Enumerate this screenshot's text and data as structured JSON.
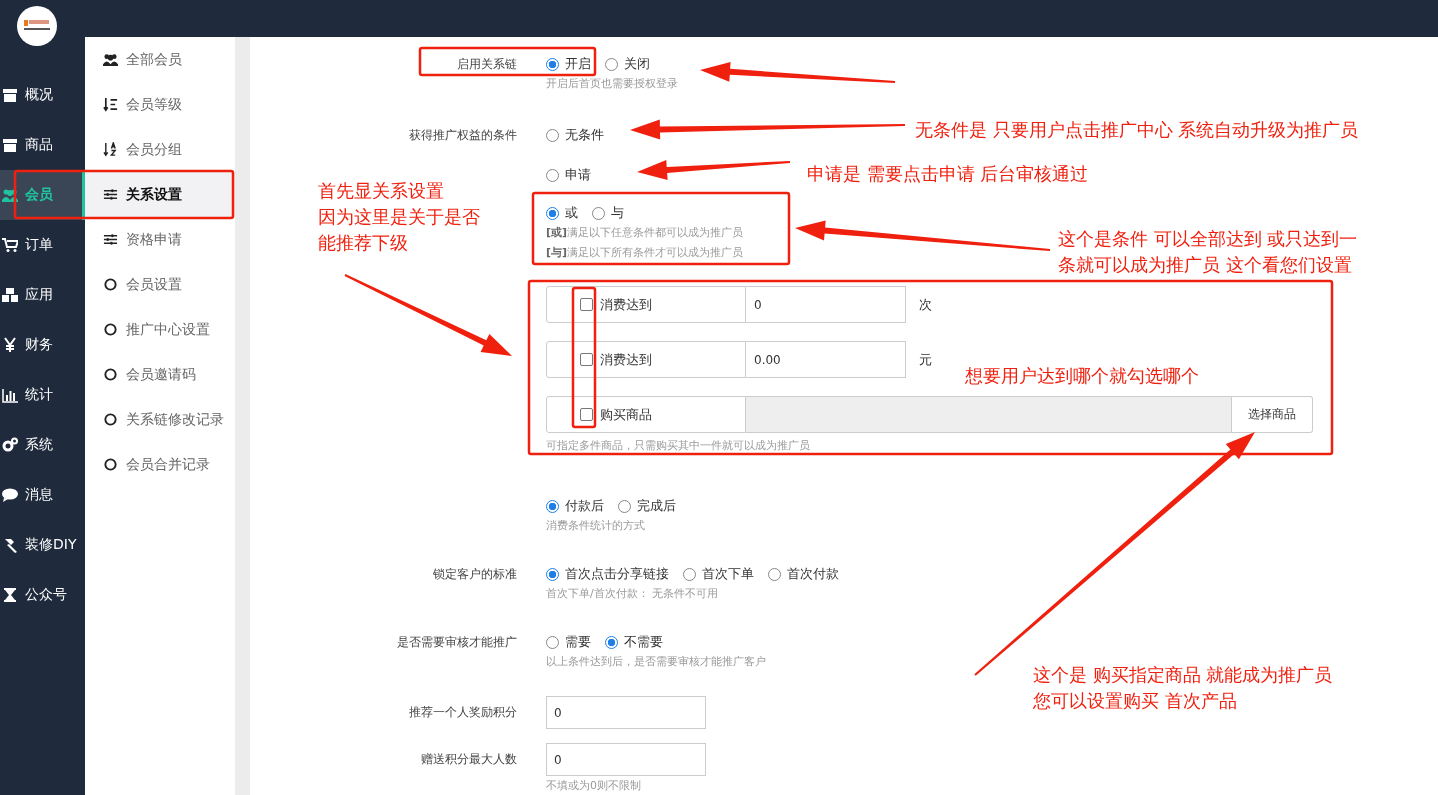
{
  "sidebar": {
    "items": [
      {
        "label": "概况",
        "selected": false
      },
      {
        "label": "商品",
        "selected": false
      },
      {
        "label": "会员",
        "selected": true
      },
      {
        "label": "订单",
        "selected": false
      },
      {
        "label": "应用",
        "selected": false
      },
      {
        "label": "财务",
        "selected": false
      },
      {
        "label": "统计",
        "selected": false
      },
      {
        "label": "系统",
        "selected": false
      },
      {
        "label": "消息",
        "selected": false
      },
      {
        "label": "装修DIY",
        "selected": false
      },
      {
        "label": "公众号",
        "selected": false
      }
    ]
  },
  "submenu": {
    "items": [
      {
        "label": "全部会员",
        "selected": false
      },
      {
        "label": "会员等级",
        "selected": false
      },
      {
        "label": "会员分组",
        "selected": false
      },
      {
        "label": "关系设置",
        "selected": true
      },
      {
        "label": "资格申请",
        "selected": false
      },
      {
        "label": "会员设置",
        "selected": false
      },
      {
        "label": "推广中心设置",
        "selected": false
      },
      {
        "label": "会员邀请码",
        "selected": false
      },
      {
        "label": "关系链修改记录",
        "selected": false
      },
      {
        "label": "会员合并记录",
        "selected": false
      }
    ]
  },
  "form": {
    "rows": [
      {
        "kind": "radio",
        "label": "启用关系链",
        "options": [
          {
            "label": "开启",
            "selected": true
          },
          {
            "label": "关闭",
            "selected": false
          }
        ],
        "hints": [
          "开启后首页也需要授权登录"
        ]
      },
      {
        "kind": "radio",
        "label": "获得推广权益的条件",
        "options": [
          {
            "label": "无条件",
            "selected": false
          }
        ]
      },
      {
        "kind": "radio",
        "options": [
          {
            "label": "申请",
            "selected": false
          }
        ]
      },
      {
        "kind": "radio",
        "options": [
          {
            "label": "或",
            "selected": true
          },
          {
            "label": "与",
            "selected": false
          }
        ],
        "hints": [
          "**[或]**满足以下任意条件都可以成为推广员",
          "**[与]**满足以下所有条件才可以成为推广员"
        ]
      },
      {
        "kind": "conditions",
        "items": [
          {
            "label": "消费达到",
            "checked": false,
            "value": "0",
            "unit": "次"
          },
          {
            "label": "消费达到",
            "checked": false,
            "value": "0.00",
            "unit": "元"
          },
          {
            "label": "购买商品",
            "checked": false,
            "button": "选择商品"
          }
        ],
        "hints": [
          "可指定多件商品，只需购买其中一件就可以成为推广员"
        ]
      },
      {
        "kind": "radio",
        "options": [
          {
            "label": "付款后",
            "selected": true
          },
          {
            "label": "完成后",
            "selected": false
          }
        ],
        "hints": [
          "消费条件统计的方式"
        ]
      },
      {
        "kind": "radio",
        "label": "锁定客户的标准",
        "options": [
          {
            "label": "首次点击分享链接",
            "selected": true
          },
          {
            "label": "首次下单",
            "selected": false
          },
          {
            "label": "首次付款",
            "selected": false
          }
        ],
        "hints": [
          "首次下单/首次付款：  无条件不可用"
        ]
      },
      {
        "kind": "radio",
        "label": "是否需要审核才能推广",
        "options": [
          {
            "label": "需要",
            "selected": false
          },
          {
            "label": "不需要",
            "selected": true
          }
        ],
        "hints": [
          "以上条件达到后，是否需要审核才能推广客户"
        ]
      },
      {
        "kind": "input",
        "label": "推荐一个人奖励积分",
        "value": "0"
      },
      {
        "kind": "input",
        "label": "赠送积分最大人数",
        "value": "0",
        "hints": [
          "不填或为0则不限制"
        ]
      }
    ]
  },
  "annotations": {
    "notes": [
      {
        "lines": [
          "首先显关系设置",
          "因为这里是关于是否",
          "能推荐下级"
        ]
      },
      {
        "lines": [
          "无条件是 只要用户点击推广中心 系统自动升级为推广员"
        ]
      },
      {
        "lines": [
          "申请是 需要点击申请 后台审核通过"
        ]
      },
      {
        "lines": [
          "这个是条件  可以全部达到 或只达到一",
          "条就可以成为推广员  这个看您们设置"
        ]
      },
      {
        "lines": [
          "想要用户达到哪个就勾选哪个"
        ]
      },
      {
        "lines": [
          "这个是 购买指定商品 就能成为推广员",
          "您可以设置购买 首次产品"
        ]
      }
    ]
  }
}
